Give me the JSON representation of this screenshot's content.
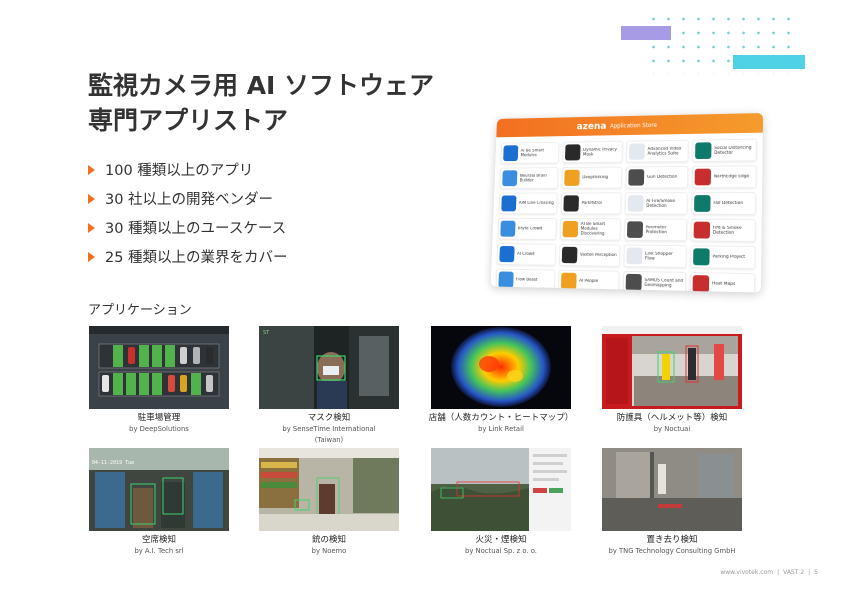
{
  "title_lines": [
    "監視カメラ用 AI ソフトウェア",
    "専門アプリストア"
  ],
  "bullets": [
    "100 種類以上のアプリ",
    "30 社以上の開発ベンダー",
    "30 種類以上のユースケース",
    "25 種類以上の業界をカバー"
  ],
  "store": {
    "logo": "azena",
    "subtitle": "Application Store",
    "tiles": [
      "AI Be Smart Modules",
      "Dynamic Privacy Mask",
      "Advanced Video Analytics Suite",
      "Social Distancing Detector",
      "Neurala Brain Builder",
      "DeepParking",
      "Gun Detection",
      "NorthEdge Edge",
      "AIM Line Crossing",
      "ParkPatrol",
      "AI Fire/Smoke Detection",
      "Fall Detection",
      "Bryte Crowd",
      "AI Be Smart Modules Discovering",
      "Perimeter Protection",
      "Fire & Smoke Detection",
      "AI Crowd",
      "Vaxtell Perception",
      "Link Shopper Flow",
      "Parking Project",
      "Flow Beast",
      "AI People",
      "SAMOS Count and Geomapping",
      "Heat Maps"
    ]
  },
  "section_label": "アプリケーション",
  "apps": [
    {
      "name": "駐車場管理",
      "by": "by DeepSolutions"
    },
    {
      "name": "マスク検知",
      "by": "by SenseTime International",
      "by2": "(Taiwan)"
    },
    {
      "name": "店舗（人数カウント・ヒートマップ）",
      "by": "by Link Retail"
    },
    {
      "name": "防護具（ヘルメット等）検知",
      "by": "by Noctuai"
    },
    {
      "name": "空席検知",
      "by": "by A.I. Tech srl"
    },
    {
      "name": "銃の検知",
      "by": "by Noemo"
    },
    {
      "name": "火災・煙検知",
      "by": "by Noctuai Sp. z o. o."
    },
    {
      "name": "置き去り検知",
      "by": "by TNG Technology Consulting GmbH"
    }
  ],
  "footer": {
    "site": "www.vivotek.com",
    "deck": "VAST 2",
    "page": "5"
  },
  "colors": {
    "accent": "#f37021",
    "purple": "#a89be6",
    "cyan": "#4fd2e5"
  }
}
